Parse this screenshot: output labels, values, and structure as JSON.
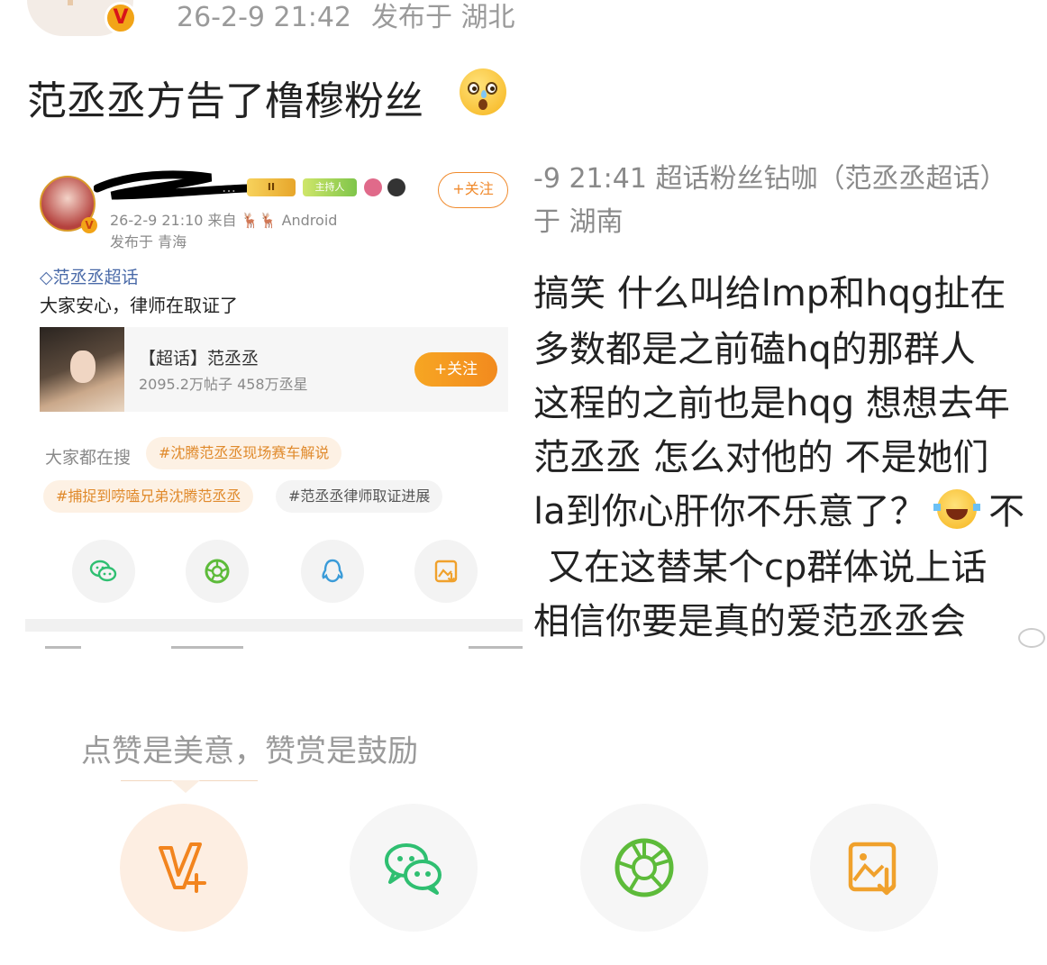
{
  "post": {
    "author_avatar_text": "饭",
    "verified_badge": "V",
    "timestamp": "26-2-9 21:42",
    "location": "发布于 湖北",
    "text": "范丞丞方告了橹穆粉丝",
    "emoji": "astonished-tear-face"
  },
  "left_screenshot": {
    "user": {
      "name_visible_tail": "…",
      "crown_badge": "II",
      "host_badge": "主持人",
      "follow_button": "+关注",
      "time_and_source": "26-2-9 21:10  来自 🦌🦌 Android",
      "location": "发布于 青海"
    },
    "topic": "范丞丞超话",
    "body": "大家安心，律师在取证了",
    "supertopic_card": {
      "title": "【超话】范丞丞",
      "stats": "2095.2万帖子 458万丞星",
      "follow_button": "+关注"
    },
    "search": {
      "label": "大家都在搜",
      "tags": [
        "#沈腾范丞丞现场赛车解说",
        "#捕捉到唠嗑兄弟沈腾范丞丞",
        "#范丞丞律师取证进展"
      ]
    },
    "share_icons": [
      "wechat-icon",
      "moments-icon",
      "qq-icon",
      "save-image-icon"
    ]
  },
  "right_screenshot": {
    "meta_line1": "-9 21:41  超话粉丝钻咖（范丞丞超话）",
    "meta_line2": "于 湖南",
    "lines": [
      "搞笑 什么叫给lmp和hqg扯在",
      "多数都是之前磕hq的那群人",
      "这程的之前也是hqg 想想去年",
      "范丞丞 怎么对他的  不是她们",
      "la到你心肝你不乐意了？",
      "又在这替某个cp群体说上话",
      "相信你要是真的爱范丞丞会"
    ],
    "line5_tail": "不"
  },
  "reward": {
    "text": "点赞是美意，赞赏是鼓励",
    "buttons": [
      "reward-v-icon",
      "wechat-icon",
      "moments-icon",
      "save-image-icon"
    ]
  },
  "colors": {
    "accent_orange": "#f28a1e",
    "wechat_green": "#2fbf71",
    "moments_green": "#5dbb3a",
    "qq_blue": "#3a9bd8",
    "muted_text": "#9a9a9a"
  }
}
